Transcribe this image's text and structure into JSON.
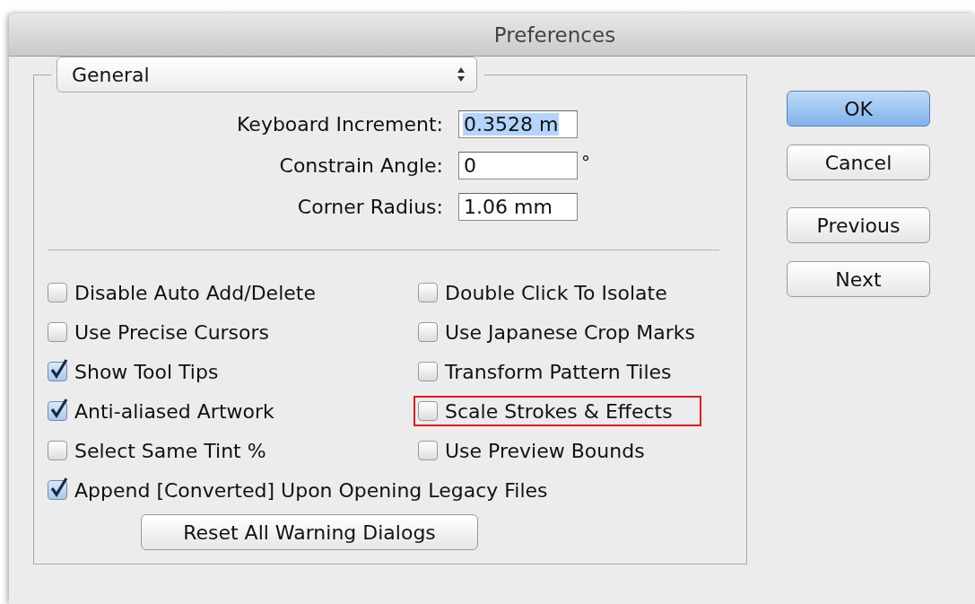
{
  "window": {
    "title": "Preferences"
  },
  "category_popup": {
    "value": "General"
  },
  "fields": [
    {
      "label": "Keyboard Increment:",
      "value": "0.3528 m",
      "text_selected": true
    },
    {
      "label": "Constrain Angle:",
      "value": "0",
      "unit": "°",
      "text_selected": false
    },
    {
      "label": "Corner Radius:",
      "value": "1.06 mm",
      "text_selected": false
    }
  ],
  "left_options": [
    {
      "label": "Disable Auto Add/Delete",
      "checked": false,
      "highlighted": false
    },
    {
      "label": "Use Precise Cursors",
      "checked": false,
      "highlighted": false
    },
    {
      "label": "Show Tool Tips",
      "checked": true,
      "highlighted": false
    },
    {
      "label": "Anti-aliased Artwork",
      "checked": true,
      "highlighted": false
    },
    {
      "label": "Select Same Tint %",
      "checked": false,
      "highlighted": false
    },
    {
      "label": "Append [Converted] Upon Opening Legacy Files",
      "checked": true,
      "highlighted": false
    }
  ],
  "right_options": [
    {
      "label": "Double Click To Isolate",
      "checked": false,
      "highlighted": false
    },
    {
      "label": "Use Japanese Crop Marks",
      "checked": false,
      "highlighted": false
    },
    {
      "label": "Transform Pattern Tiles",
      "checked": false,
      "highlighted": false
    },
    {
      "label": "Scale Strokes & Effects",
      "checked": false,
      "highlighted": true
    },
    {
      "label": "Use Preview Bounds",
      "checked": false,
      "highlighted": false
    }
  ],
  "reset_button": "Reset All Warning Dialogs",
  "buttons": [
    {
      "label": "OK",
      "default": true
    },
    {
      "label": "Cancel",
      "default": false
    },
    {
      "label": "Previous",
      "default": false
    },
    {
      "label": "Next",
      "default": false
    }
  ]
}
